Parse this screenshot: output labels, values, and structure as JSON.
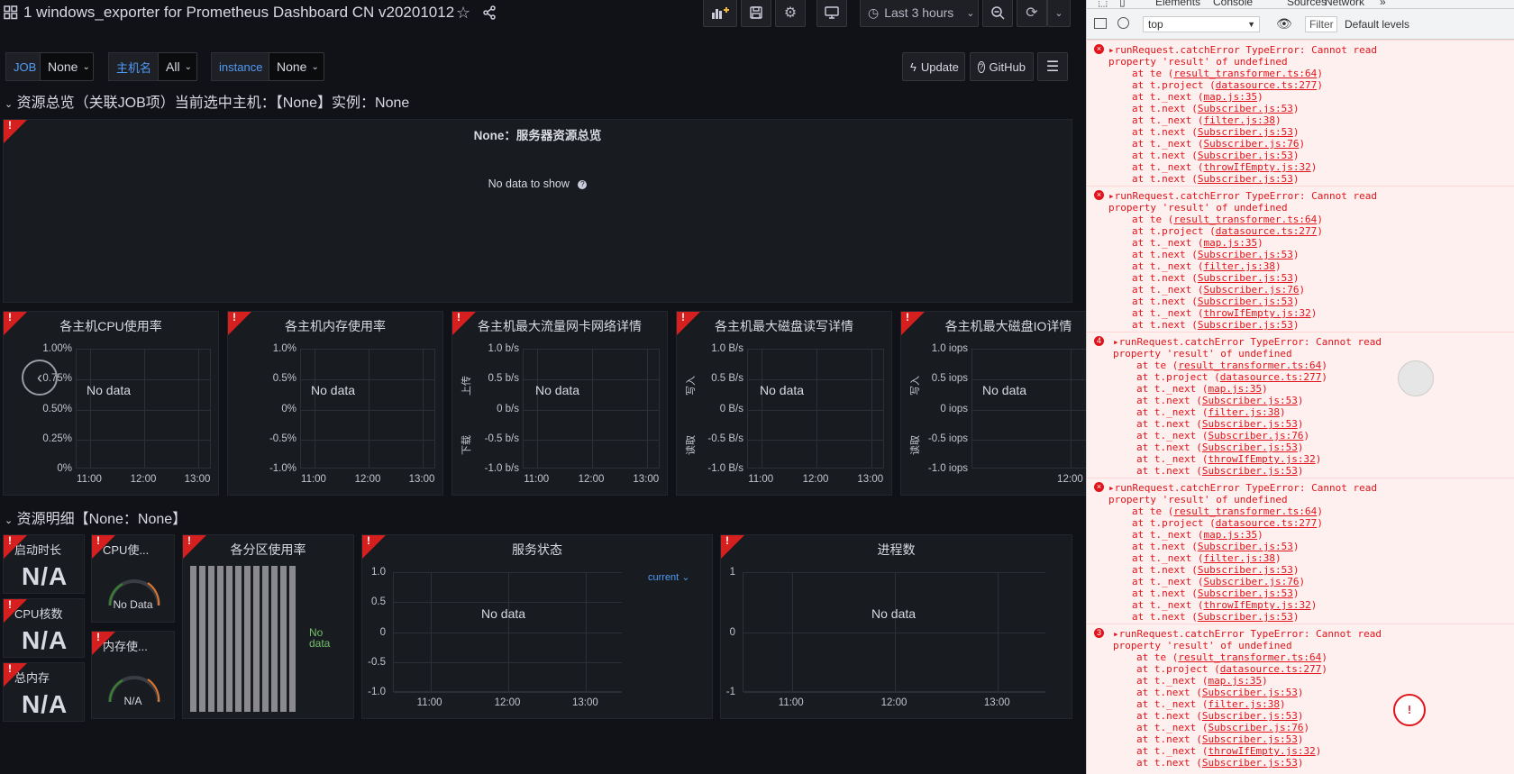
{
  "dashboard": {
    "title": "1 windows_exporter for Prometheus Dashboard CN v20201012",
    "time_range": "Last 3 hours"
  },
  "variables": [
    {
      "label": "JOB",
      "value": "None"
    },
    {
      "label": "主机名",
      "value": "All"
    },
    {
      "label": "instance",
      "value": "None"
    }
  ],
  "right_buttons": {
    "update": "Update",
    "github": "GitHub"
  },
  "rows": {
    "row1": "资源总览（关联JOB项）当前选中主机：【None】实例：None",
    "row2": "资源明细【None：None】"
  },
  "overview_panel": {
    "title": "None：服务器资源总览",
    "empty": "No data to show"
  },
  "graphs": [
    {
      "title": "各主机CPU使用率",
      "yticks": [
        "1.00%",
        "0.75%",
        "0.50%",
        "0.25%",
        "0%"
      ],
      "xticks": [
        "11:00",
        "12:00",
        "13:00"
      ],
      "empty": "No data",
      "axis_top": "",
      "axis_bottom": ""
    },
    {
      "title": "各主机内存使用率",
      "yticks": [
        "1.0%",
        "0.5%",
        "0%",
        "-0.5%",
        "-1.0%"
      ],
      "xticks": [
        "11:00",
        "12:00",
        "13:00"
      ],
      "empty": "No data",
      "axis_top": "",
      "axis_bottom": ""
    },
    {
      "title": "各主机最大流量网卡网络详情",
      "yticks": [
        "1.0 b/s",
        "0.5 b/s",
        "0 b/s",
        "-0.5 b/s",
        "-1.0 b/s"
      ],
      "xticks": [
        "11:00",
        "12:00",
        "13:00"
      ],
      "empty": "No data",
      "axis_top": "上传",
      "axis_bottom": "下载"
    },
    {
      "title": "各主机最大磁盘读写详情",
      "yticks": [
        "1.0 B/s",
        "0.5 B/s",
        "0 B/s",
        "-0.5 B/s",
        "-1.0 B/s"
      ],
      "xticks": [
        "11:00",
        "12:00",
        "13:00"
      ],
      "empty": "No data",
      "axis_top": "写入",
      "axis_bottom": "读取"
    },
    {
      "title": "各主机最大磁盘IO详情",
      "yticks": [
        "1.0 iops",
        "0.5 iops",
        "0 iops",
        "-0.5 iops",
        "-1.0 iops"
      ],
      "xticks": [
        "12:00"
      ],
      "empty": "No data",
      "axis_top": "写入",
      "axis_bottom": "读取"
    }
  ],
  "stats": [
    {
      "title": "启动时长",
      "value": "N/A"
    },
    {
      "title": "CPU核数",
      "value": "N/A"
    },
    {
      "title": "总内存",
      "value": "N/A"
    }
  ],
  "gauges": [
    {
      "title": "CPU使...",
      "value": "No Data"
    },
    {
      "title": "内存使...",
      "value": "N/A"
    }
  ],
  "bargauge": {
    "title": "各分区使用率",
    "empty": "No data"
  },
  "service_panel": {
    "title": "服务状态",
    "yticks": [
      "1.0",
      "0.5",
      "0",
      "-0.5",
      "-1.0"
    ],
    "xticks": [
      "11:00",
      "12:00",
      "13:00"
    ],
    "empty": "No data",
    "legend": "current"
  },
  "process_panel": {
    "title": "进程数",
    "yticks": [
      "1",
      "0",
      "-1"
    ],
    "xticks": [
      "11:00",
      "12:00",
      "13:00"
    ],
    "empty": "No data"
  },
  "devtools": {
    "tabs": [
      "Elements",
      "Console",
      "Sources",
      "Network"
    ],
    "context": "top",
    "filter": "Filter",
    "levels": "Default levels",
    "errors": [
      {
        "badge": "×",
        "head": "runRequest.catchError TypeError: Cannot read\nproperty 'result' of undefined"
      },
      {
        "badge": "×",
        "head": "runRequest.catchError TypeError: Cannot read\nproperty 'result' of undefined"
      },
      {
        "badge": "4",
        "head": "runRequest.catchError TypeError: Cannot read\nproperty 'result' of undefined"
      },
      {
        "badge": "×",
        "head": "runRequest.catchError TypeError: Cannot read\nproperty 'result' of undefined"
      },
      {
        "badge": "3",
        "head": "runRequest.catchError TypeError: Cannot read\nproperty 'result' of undefined"
      }
    ],
    "stack": [
      [
        "at te (",
        "result_transformer.ts:64",
        ")"
      ],
      [
        "at t.project (",
        "datasource.ts:277",
        ")"
      ],
      [
        "at t._next (",
        "map.js:35",
        ")"
      ],
      [
        "at t.next (",
        "Subscriber.js:53",
        ")"
      ],
      [
        "at t._next (",
        "filter.js:38",
        ")"
      ],
      [
        "at t.next (",
        "Subscriber.js:53",
        ")"
      ],
      [
        "at t._next (",
        "Subscriber.js:76",
        ")"
      ],
      [
        "at t.next (",
        "Subscriber.js:53",
        ")"
      ],
      [
        "at t._next (",
        "throwIfEmpty.js:32",
        ")"
      ],
      [
        "at t.next (",
        "Subscriber.js:53",
        ")"
      ]
    ]
  }
}
